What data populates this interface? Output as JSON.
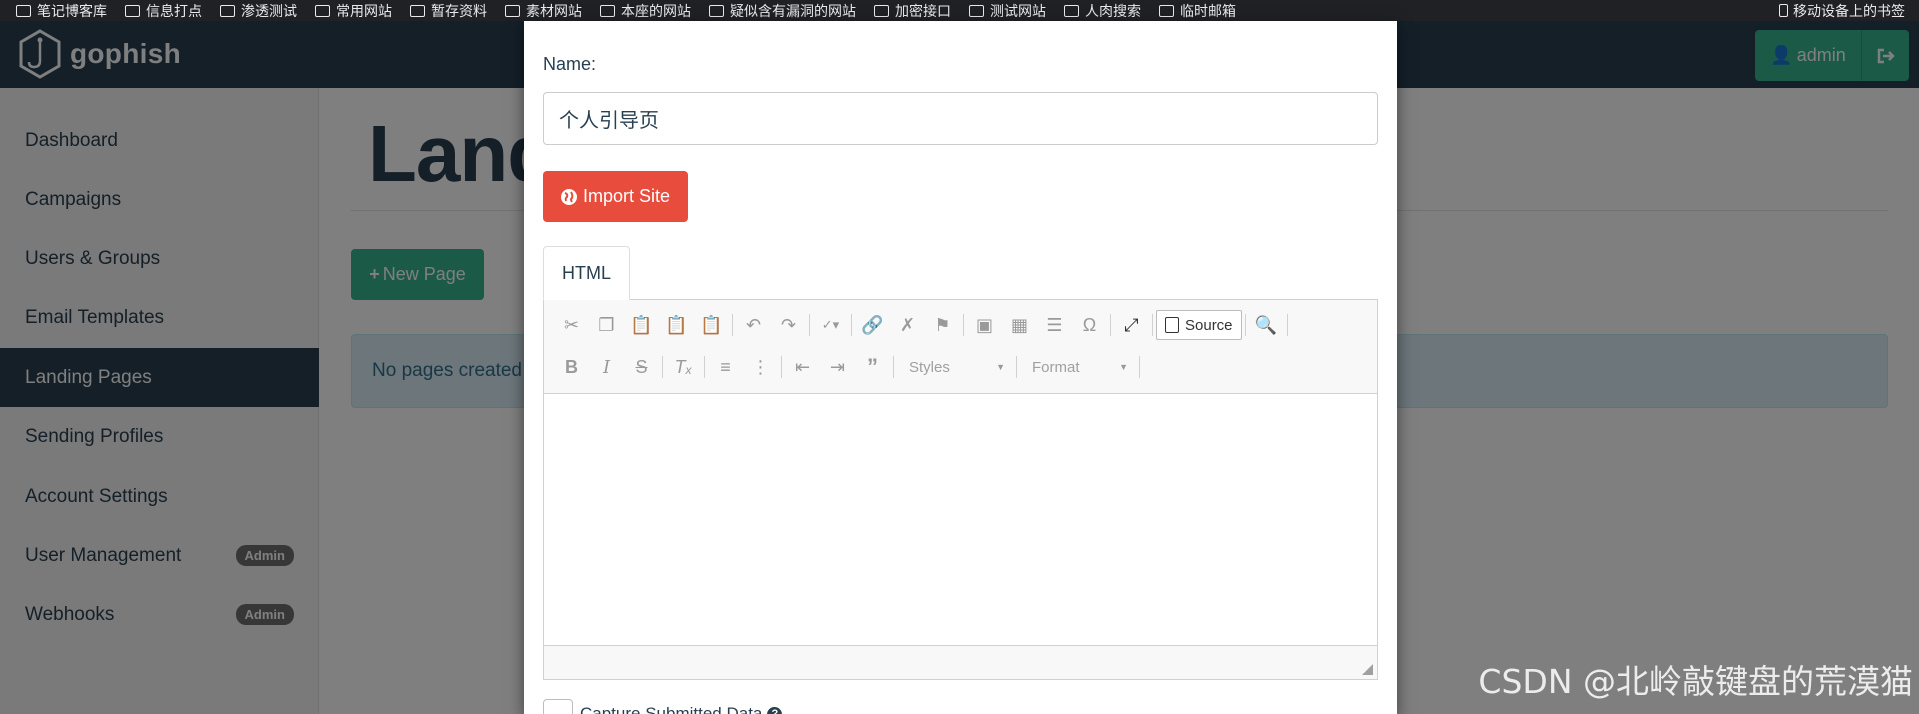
{
  "bookmarks": {
    "items": [
      "笔记博客库",
      "信息打点",
      "渗透测试",
      "常用网站",
      "暂存资料",
      "素材网站",
      "本座的网站",
      "疑似含有漏洞的网站",
      "加密接口",
      "测试网站",
      "人肉搜索",
      "临时邮箱"
    ],
    "mobile_label": "移动设备上的书签"
  },
  "navbar": {
    "brand": "gophish",
    "admin_label": "admin"
  },
  "sidebar": {
    "items": [
      {
        "label": "Dashboard"
      },
      {
        "label": "Campaigns"
      },
      {
        "label": "Users & Groups"
      },
      {
        "label": "Email Templates"
      },
      {
        "label": "Landing Pages"
      },
      {
        "label": "Sending Profiles"
      },
      {
        "label": "Account Settings"
      },
      {
        "label": "User Management",
        "badge": "Admin"
      },
      {
        "label": "Webhooks",
        "badge": "Admin"
      }
    ],
    "active": "Landing Pages"
  },
  "main": {
    "title": "Land",
    "new_page_label": "New Page",
    "alert": "No pages created y"
  },
  "modal": {
    "name_label": "Name:",
    "name_value": "个人引导页",
    "import_label": "Import Site",
    "tab_label": "HTML",
    "toolbar": {
      "source_label": "Source",
      "styles_label": "Styles",
      "format_label": "Format"
    },
    "capture_label": "Capture Submitted Data"
  },
  "watermark": "CSDN @北岭敲键盘的荒漠猫"
}
